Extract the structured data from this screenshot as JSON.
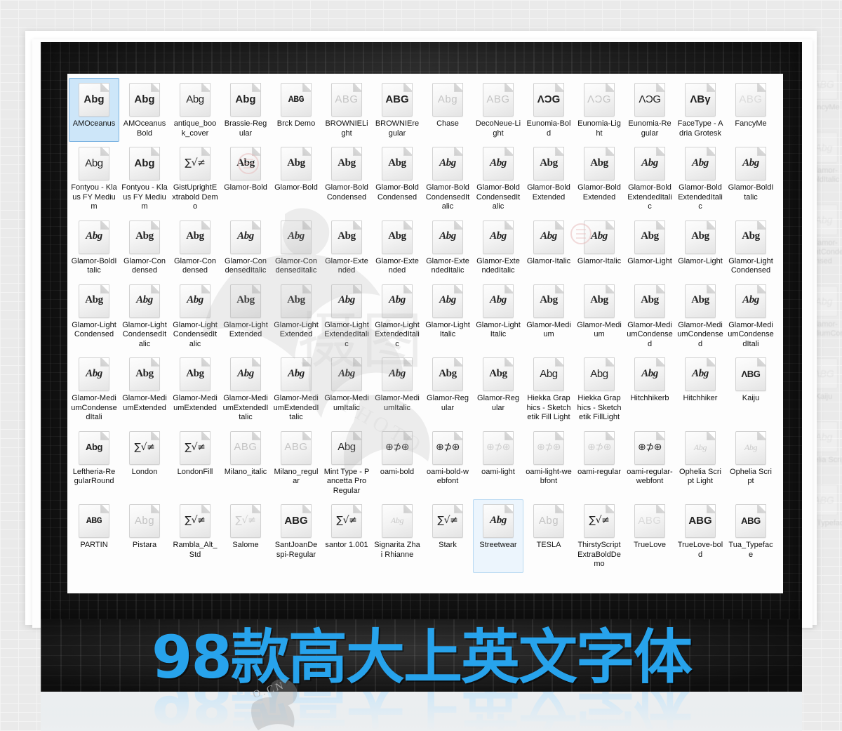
{
  "banner": {
    "headline": "98款高大上英文字体",
    "accent_color": "#27a3ec",
    "reflection_color": "#cde7f8"
  },
  "watermarks": {
    "center_mark": "摄图",
    "photo_mark": "PHOTO",
    "bottom_mark": "O.CN"
  },
  "panel": {
    "selected_item": "AMOceanus",
    "hovered_item": "Streetwear",
    "columns": 14,
    "rows": 7,
    "items": [
      {
        "label": "AMOceanus",
        "glyph": "Abg",
        "style": "g-sansb",
        "state": "selected"
      },
      {
        "label": "AMOceanusBold",
        "glyph": "Abg",
        "style": "g-sansb",
        "state": "normal"
      },
      {
        "label": "antique_book_cover",
        "glyph": "Abg",
        "style": "g-sans",
        "state": "normal"
      },
      {
        "label": "Brassie-Regular",
        "glyph": "Abg",
        "style": "g-sansb",
        "state": "normal"
      },
      {
        "label": "Brck Demo",
        "glyph": "ABG",
        "style": "g-mono",
        "state": "normal"
      },
      {
        "label": "BROWNIELight",
        "glyph": "ABG",
        "style": "g-light",
        "state": "normal"
      },
      {
        "label": "BROWNIEregular",
        "glyph": "ABG",
        "style": "g-sansb",
        "state": "normal"
      },
      {
        "label": "Chase",
        "glyph": "Abg",
        "style": "g-light",
        "state": "normal"
      },
      {
        "label": "DecoNeue-Light",
        "glyph": "ABG",
        "style": "g-light",
        "state": "normal"
      },
      {
        "label": "Eunomia-Bold",
        "glyph": "ΛƆG",
        "style": "g-sansb",
        "state": "normal"
      },
      {
        "label": "Eunomia-Light",
        "glyph": "ΛƆG",
        "style": "g-light",
        "state": "normal"
      },
      {
        "label": "Eunomia-Regular",
        "glyph": "ΛƆG",
        "style": "g-sans",
        "state": "normal"
      },
      {
        "label": "FaceType - Adria Grotesk",
        "glyph": "ΛΒγ",
        "style": "g-sansb",
        "state": "normal"
      },
      {
        "label": "FancyMe",
        "glyph": "ABG",
        "style": "g-vlight",
        "state": "normal"
      },
      {
        "label": "Fontyou - Klaus FY Medium",
        "glyph": "Abg",
        "style": "g-sans",
        "state": "normal"
      },
      {
        "label": "Fontyou - Klaus FY Medium",
        "glyph": "Abg",
        "style": "g-sansb",
        "state": "normal"
      },
      {
        "label": "GistUprightExtrabold Demo",
        "glyph": "∑√≠",
        "style": "g-math",
        "state": "normal"
      },
      {
        "label": "Glamor-Bold",
        "glyph": "Abg",
        "style": "g-serif",
        "state": "normal"
      },
      {
        "label": "Glamor-Bold",
        "glyph": "Abg",
        "style": "g-serif",
        "state": "normal"
      },
      {
        "label": "Glamor-BoldCondensed",
        "glyph": "Abg",
        "style": "g-serif",
        "state": "normal"
      },
      {
        "label": "Glamor-BoldCondensed",
        "glyph": "Abg",
        "style": "g-serif",
        "state": "normal"
      },
      {
        "label": "Glamor-BoldCondensedItalic",
        "glyph": "Abg",
        "style": "g-seriffi",
        "state": "normal"
      },
      {
        "label": "Glamor-BoldCondensedItalic",
        "glyph": "Abg",
        "style": "g-seriffi",
        "state": "normal"
      },
      {
        "label": "Glamor-BoldExtended",
        "glyph": "Abg",
        "style": "g-serif",
        "state": "normal"
      },
      {
        "label": "Glamor-BoldExtended",
        "glyph": "Abg",
        "style": "g-serif",
        "state": "normal"
      },
      {
        "label": "Glamor-BoldExtendedItalic",
        "glyph": "Abg",
        "style": "g-seriffi",
        "state": "normal"
      },
      {
        "label": "Glamor-BoldExtendedItalic",
        "glyph": "Abg",
        "style": "g-seriffi",
        "state": "normal"
      },
      {
        "label": "Glamor-BoldItalic",
        "glyph": "Abg",
        "style": "g-seriffi",
        "state": "normal"
      },
      {
        "label": "Glamor-BoldItalic",
        "glyph": "Abg",
        "style": "g-seriffi",
        "state": "normal"
      },
      {
        "label": "Glamor-Condensed",
        "glyph": "Abg",
        "style": "g-serif",
        "state": "normal"
      },
      {
        "label": "Glamor-Condensed",
        "glyph": "Abg",
        "style": "g-serif",
        "state": "normal"
      },
      {
        "label": "Glamor-CondensedItalic",
        "glyph": "Abg",
        "style": "g-seriffi",
        "state": "normal"
      },
      {
        "label": "Glamor-CondensedItalic",
        "glyph": "Abg",
        "style": "g-seriffi",
        "state": "normal"
      },
      {
        "label": "Glamor-Extended",
        "glyph": "Abg",
        "style": "g-serif",
        "state": "normal"
      },
      {
        "label": "Glamor-Extended",
        "glyph": "Abg",
        "style": "g-serif",
        "state": "normal"
      },
      {
        "label": "Glamor-ExtendedItalic",
        "glyph": "Abg",
        "style": "g-seriffi",
        "state": "normal"
      },
      {
        "label": "Glamor-ExtendedItalic",
        "glyph": "Abg",
        "style": "g-seriffi",
        "state": "normal"
      },
      {
        "label": "Glamor-Italic",
        "glyph": "Abg",
        "style": "g-seriffi",
        "state": "normal"
      },
      {
        "label": "Glamor-Italic",
        "glyph": "Abg",
        "style": "g-seriffi",
        "state": "normal"
      },
      {
        "label": "Glamor-Light",
        "glyph": "Abg",
        "style": "g-serif",
        "state": "normal"
      },
      {
        "label": "Glamor-Light",
        "glyph": "Abg",
        "style": "g-serif",
        "state": "normal"
      },
      {
        "label": "Glamor-LightCondensed",
        "glyph": "Abg",
        "style": "g-serif",
        "state": "normal"
      },
      {
        "label": "Glamor-LightCondensed",
        "glyph": "Abg",
        "style": "g-serif",
        "state": "normal"
      },
      {
        "label": "Glamor-LightCondensedItalic",
        "glyph": "Abg",
        "style": "g-seriffi",
        "state": "normal"
      },
      {
        "label": "Glamor-LightCondensedItalic",
        "glyph": "Abg",
        "style": "g-seriffi",
        "state": "normal"
      },
      {
        "label": "Glamor-LightExtended",
        "glyph": "Abg",
        "style": "g-serif",
        "state": "normal"
      },
      {
        "label": "Glamor-LightExtended",
        "glyph": "Abg",
        "style": "g-serif",
        "state": "normal"
      },
      {
        "label": "Glamor-LightExtendedItalic",
        "glyph": "Abg",
        "style": "g-seriffi",
        "state": "normal"
      },
      {
        "label": "Glamor-LightExtendedItalic",
        "glyph": "Abg",
        "style": "g-seriffi",
        "state": "normal"
      },
      {
        "label": "Glamor-LightItalic",
        "glyph": "Abg",
        "style": "g-seriffi",
        "state": "normal"
      },
      {
        "label": "Glamor-LightItalic",
        "glyph": "Abg",
        "style": "g-seriffi",
        "state": "normal"
      },
      {
        "label": "Glamor-Medium",
        "glyph": "Abg",
        "style": "g-serif",
        "state": "normal"
      },
      {
        "label": "Glamor-Medium",
        "glyph": "Abg",
        "style": "g-serif",
        "state": "normal"
      },
      {
        "label": "Glamor-MediumCondensed",
        "glyph": "Abg",
        "style": "g-serif",
        "state": "normal"
      },
      {
        "label": "Glamor-MediumCondensed",
        "glyph": "Abg",
        "style": "g-serif",
        "state": "normal"
      },
      {
        "label": "Glamor-MediumCondensedItali",
        "glyph": "Abg",
        "style": "g-seriffi",
        "state": "normal"
      },
      {
        "label": "Glamor-MediumCondensedItali",
        "glyph": "Abg",
        "style": "g-seriffi",
        "state": "normal"
      },
      {
        "label": "Glamor-MediumExtended",
        "glyph": "Abg",
        "style": "g-serif",
        "state": "normal"
      },
      {
        "label": "Glamor-MediumExtended",
        "glyph": "Abg",
        "style": "g-serif",
        "state": "normal"
      },
      {
        "label": "Glamor-MediumExtendedItalic",
        "glyph": "Abg",
        "style": "g-seriffi",
        "state": "normal"
      },
      {
        "label": "Glamor-MediumExtendedItalic",
        "glyph": "Abg",
        "style": "g-seriffi",
        "state": "normal"
      },
      {
        "label": "Glamor-MediumItalic",
        "glyph": "Abg",
        "style": "g-seriffi",
        "state": "normal"
      },
      {
        "label": "Glamor-MediumItalic",
        "glyph": "Abg",
        "style": "g-seriffi",
        "state": "normal"
      },
      {
        "label": "Glamor-Regular",
        "glyph": "Abg",
        "style": "g-serif",
        "state": "normal"
      },
      {
        "label": "Glamor-Regular",
        "glyph": "Abg",
        "style": "g-serif",
        "state": "normal"
      },
      {
        "label": "Hiekka Graphics - Sketchetik Fill Light",
        "glyph": "Abg",
        "style": "g-sans",
        "state": "normal"
      },
      {
        "label": "Hiekka Graphics - Sketchetik FillLight",
        "glyph": "Abg",
        "style": "g-sans",
        "state": "normal"
      },
      {
        "label": "Hitchhikerb",
        "glyph": "Abg",
        "style": "g-script",
        "state": "normal"
      },
      {
        "label": "Hitchhiker",
        "glyph": "Abg",
        "style": "g-script",
        "state": "normal"
      },
      {
        "label": "Kaiju",
        "glyph": "ΛΒG",
        "style": "g-cond",
        "state": "normal"
      },
      {
        "label": "Leftheria-RegularRound",
        "glyph": "Abg",
        "style": "g-cond",
        "state": "normal"
      },
      {
        "label": "London",
        "glyph": "∑√≠",
        "style": "g-math",
        "state": "normal"
      },
      {
        "label": "LondonFill",
        "glyph": "∑√≠",
        "style": "g-math",
        "state": "normal"
      },
      {
        "label": "Milano_italic",
        "glyph": "ABG",
        "style": "g-light",
        "state": "normal"
      },
      {
        "label": "Milano_regular",
        "glyph": "ABG",
        "style": "g-light",
        "state": "normal"
      },
      {
        "label": "Mint Type - Pancetta Pro Regular",
        "glyph": "Abg",
        "style": "g-sans",
        "state": "normal"
      },
      {
        "label": "oami-bold",
        "glyph": "⊕⊅⊛",
        "style": "g-math",
        "state": "normal"
      },
      {
        "label": "oami-bold-webfont",
        "glyph": "⊕⊅⊛",
        "style": "g-math",
        "state": "normal"
      },
      {
        "label": "oami-light",
        "glyph": "⊕⊅⊛",
        "style": "g-mathl",
        "state": "normal"
      },
      {
        "label": "oami-light-webfont",
        "glyph": "⊕⊅⊛",
        "style": "g-mathl",
        "state": "normal"
      },
      {
        "label": "oami-regular",
        "glyph": "⊕⊅⊛",
        "style": "g-mathl",
        "state": "normal"
      },
      {
        "label": "oami-regular-webfont",
        "glyph": "⊕⊅⊛",
        "style": "g-math",
        "state": "normal"
      },
      {
        "label": "Ophelia Script Light",
        "glyph": "Abg",
        "style": "g-scriptl",
        "state": "normal"
      },
      {
        "label": "Ophelia Script",
        "glyph": "Abg",
        "style": "g-scriptl",
        "state": "normal"
      },
      {
        "label": "PARTIN",
        "glyph": "ABG",
        "style": "g-mono",
        "state": "normal"
      },
      {
        "label": "Pistara",
        "glyph": "Abg",
        "style": "g-light",
        "state": "normal"
      },
      {
        "label": "Rambla_Alt_Std",
        "glyph": "∑√≠",
        "style": "g-math",
        "state": "normal"
      },
      {
        "label": "Salome",
        "glyph": "∑√≠",
        "style": "g-mathl",
        "state": "normal"
      },
      {
        "label": "SantJoanDespi-Regular",
        "glyph": "ABG",
        "style": "g-sansb",
        "state": "normal"
      },
      {
        "label": "santor 1.001",
        "glyph": "∑√≠",
        "style": "g-math",
        "state": "normal"
      },
      {
        "label": "Signarita Zhai Rhianne",
        "glyph": "Abg",
        "style": "g-scriptl",
        "state": "normal"
      },
      {
        "label": "Stark",
        "glyph": "∑√≠",
        "style": "g-math",
        "state": "normal"
      },
      {
        "label": "Streetwear",
        "glyph": "Abg",
        "style": "g-script",
        "state": "hovered"
      },
      {
        "label": "TESLA",
        "glyph": "Abg",
        "style": "g-light",
        "state": "normal"
      },
      {
        "label": "ThirstyScriptExtraBoldDemo",
        "glyph": "∑√≠",
        "style": "g-math",
        "state": "normal"
      },
      {
        "label": "TrueLove",
        "glyph": "ABG",
        "style": "g-vlight",
        "state": "normal"
      },
      {
        "label": "TrueLove-bold",
        "glyph": "ABG",
        "style": "g-sansb",
        "state": "normal"
      },
      {
        "label": "Tua_Typeface",
        "glyph": "ABG",
        "style": "g-cond",
        "state": "normal"
      }
    ]
  },
  "ghost_column": {
    "items": [
      {
        "label": "FancyMe",
        "glyph": "ABG"
      },
      {
        "label": "Glamor-BoldItalic",
        "glyph": "Abg"
      },
      {
        "label": "Glamor-LightConde nsed",
        "glyph": "Abg"
      },
      {
        "label": "Glamor-MediumCon",
        "glyph": "Abg"
      },
      {
        "label": "Kaiju",
        "glyph": "ABG"
      },
      {
        "label": "Ophelia Script",
        "glyph": "Abg"
      },
      {
        "label": "Tua_Typeface",
        "glyph": "ABG"
      }
    ]
  }
}
